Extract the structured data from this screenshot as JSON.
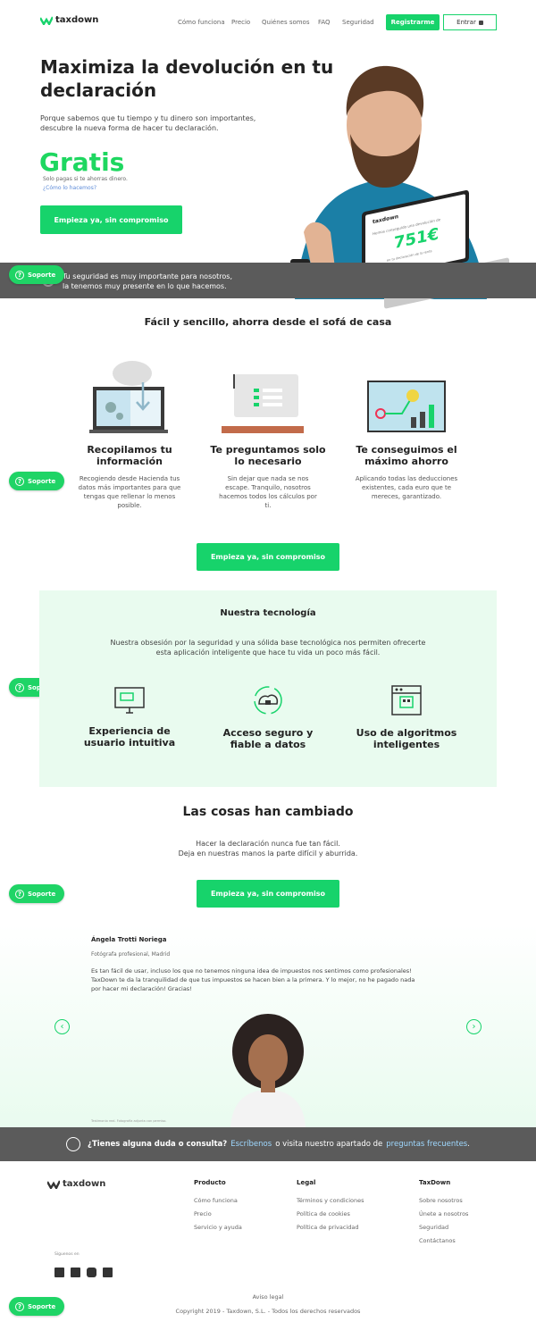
{
  "header": {
    "logo": "taxdown",
    "nav": [
      "Cómo funciona",
      "Precio",
      "Quiénes somos",
      "FAQ",
      "Seguridad"
    ],
    "register": "Registrarme",
    "login": "Entrar"
  },
  "hero": {
    "title_l1": "Maximiza la devolución en tu",
    "title_l2": "declaración",
    "sub_l1": "Porque sabemos que tu tiempo y tu dinero son importantes,",
    "sub_l2": "descubre la nueva forma de hacer tu declaración.",
    "gratis": "Gratis",
    "solo": "Solo pagas si te ahorras dinero.",
    "como": "¿Cómo lo hacemos?",
    "cta": "Empieza ya, sin compromiso",
    "laptop_brand": "taxdown",
    "laptop_line": "Hemos conseguido una devolución de",
    "laptop_amount": "751€",
    "laptop_caption": "en tu declaración de la renta"
  },
  "security_band": {
    "l1": "Tu seguridad es muy importante para nosotros,",
    "l2": "la tenemos muy presente en lo que hacemos."
  },
  "soporte": "Soporte",
  "easy": {
    "title": "Fácil y sencillo, ahorra desde el sofá de casa",
    "items": [
      {
        "title_l1": "Recopilamos tu",
        "title_l2": "información",
        "text_l1": "Recogiendo desde Hacienda tus",
        "text_l2": "datos más importantes para que",
        "text_l3": "tengas que rellenar lo menos",
        "text_l4": "posible."
      },
      {
        "title_l1": "Te preguntamos solo",
        "title_l2": "lo necesario",
        "text_l1": "Sin dejar que nada se nos",
        "text_l2": "escape. Tranquilo, nosotros",
        "text_l3": "hacemos todos los cálculos por",
        "text_l4": "ti."
      },
      {
        "title_l1": "Te conseguimos el",
        "title_l2": "máximo ahorro",
        "text_l1": "Aplicando todas las deducciones",
        "text_l2": "existentes, cada euro que te",
        "text_l3": "mereces, garantizado.",
        "text_l4": ""
      }
    ],
    "cta": "Empieza ya, sin compromiso"
  },
  "tech": {
    "title": "Nuestra tecnología",
    "sub_l1": "Nuestra obsesión por la seguridad y una sólida base tecnológica nos permiten ofrecerte",
    "sub_l2": "esta aplicación inteligente que hace tu vida un poco más fácil.",
    "items": [
      {
        "l1": "Experiencia de",
        "l2": "usuario intuitiva"
      },
      {
        "l1": "Acceso seguro y",
        "l2": "fiable a datos"
      },
      {
        "l1": "Uso de algoritmos",
        "l2": "inteligentes"
      }
    ]
  },
  "changed": {
    "title": "Las cosas han cambiado",
    "sub_l1": "Hacer la declaración nunca fue tan fácil.",
    "sub_l2": "Deja en nuestras manos la parte difícil y aburrida.",
    "cta": "Empieza ya, sin compromiso"
  },
  "testimonial": {
    "name": "Ángela Trotti Noriega",
    "role": "Fotógrafa profesional, Madrid",
    "q1": "Es tan fácil de usar, incluso los que no tenemos ninguna idea de impuestos nos sentimos como profesionales!",
    "q2": "TaxDown te da la tranquilidad de que tus impuestos se hacen bien a la primera. Y lo mejor, no he pagado nada",
    "q3": "por hacer mi declaración! Gracias!",
    "tiny": "Testimonio real. Fotografía adjunta con permiso."
  },
  "doubt": {
    "q": "¿Tienes alguna duda o consulta?",
    "link1": "Escríbenos",
    "mid": "o visita nuestro apartado de",
    "link2": "preguntas frecuentes",
    "end": "."
  },
  "footer": {
    "logo": "taxdown",
    "cols": [
      {
        "h": "Producto",
        "links": [
          "Cómo funciona",
          "Precio",
          "Servicio y ayuda"
        ]
      },
      {
        "h": "Legal",
        "links": [
          "Términos y condiciones",
          "Política de cookies",
          "Política de privacidad"
        ]
      },
      {
        "h": "TaxDown",
        "links": [
          "Sobre nosotros",
          "Únete a nosotros",
          "Seguridad",
          "Contáctanos"
        ]
      }
    ],
    "social_label": "Síguenos en",
    "aviso": "Aviso legal",
    "copy": "Copyright 2019 - Taxdown, S.L. - Todos los derechos reservados"
  },
  "colors": {
    "green": "#17d36b",
    "band": "#5b5b5b",
    "mint": "#e9fbef"
  }
}
